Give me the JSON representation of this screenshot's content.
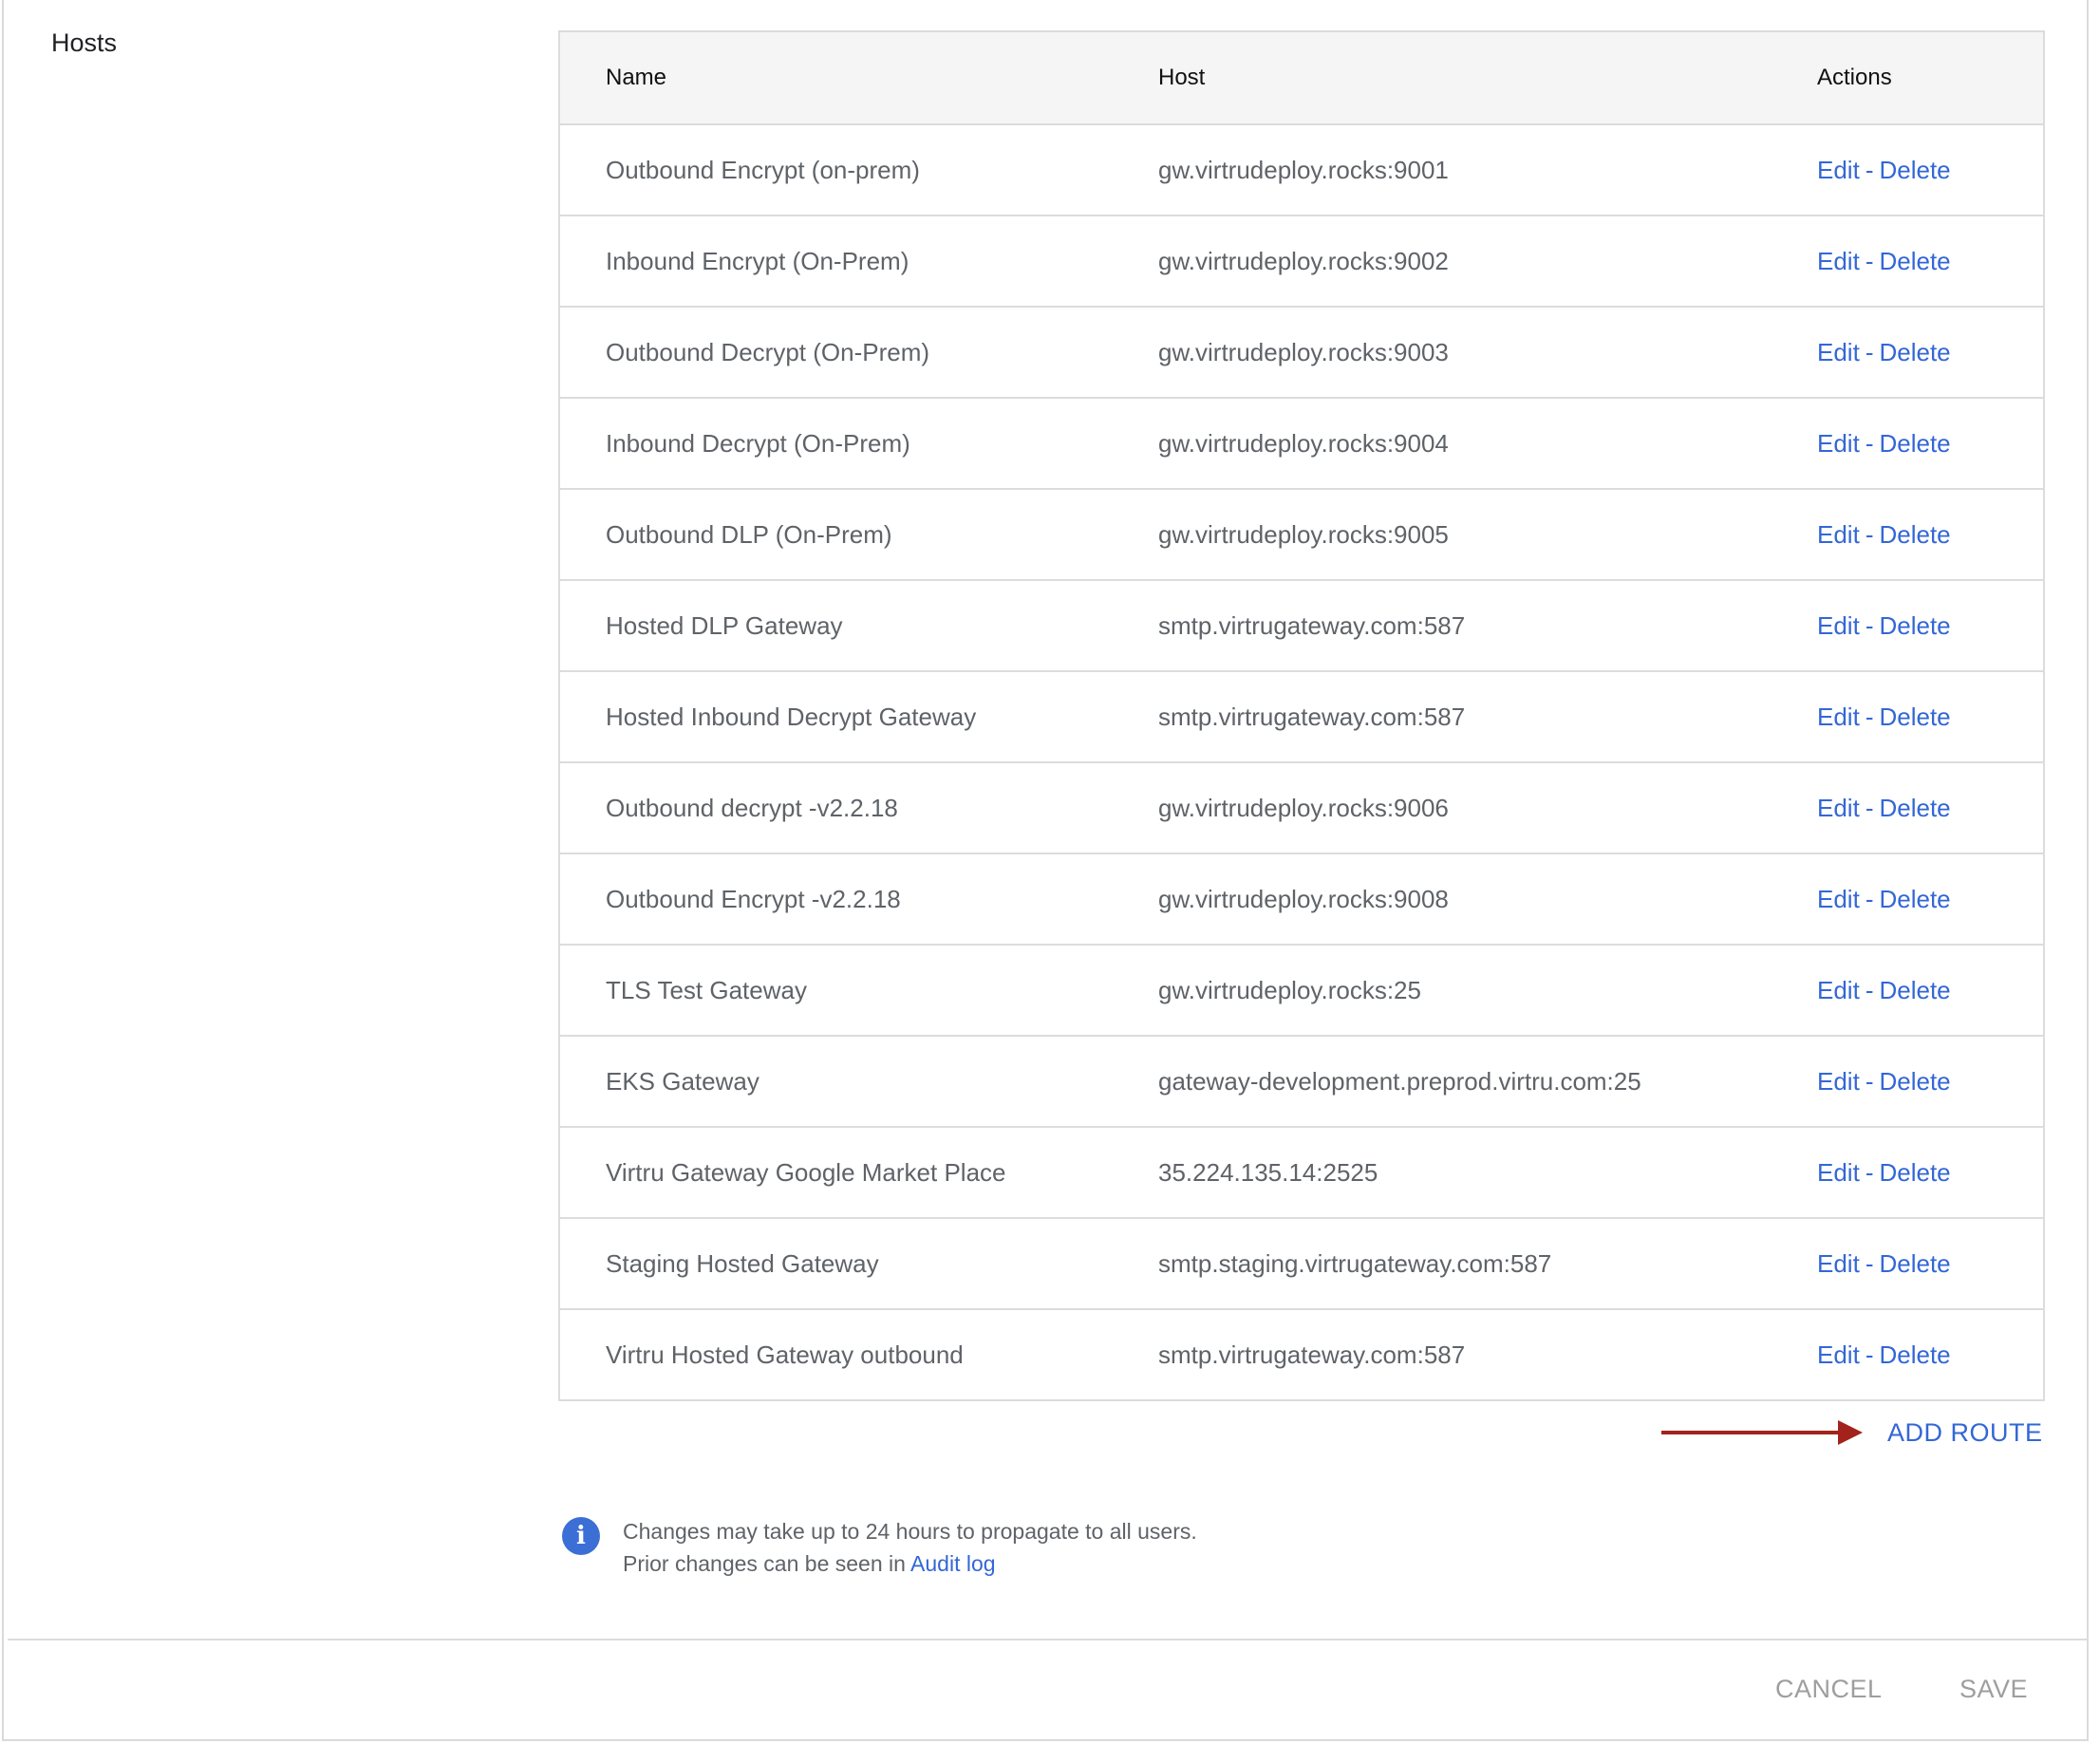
{
  "section": {
    "title": "Hosts"
  },
  "table": {
    "headers": {
      "name": "Name",
      "host": "Host",
      "actions": "Actions"
    },
    "rows": [
      {
        "name": "Outbound Encrypt (on-prem)",
        "host": "gw.virtrudeploy.rocks:9001"
      },
      {
        "name": "Inbound Encrypt (On-Prem)",
        "host": "gw.virtrudeploy.rocks:9002"
      },
      {
        "name": "Outbound Decrypt (On-Prem)",
        "host": "gw.virtrudeploy.rocks:9003"
      },
      {
        "name": "Inbound Decrypt (On-Prem)",
        "host": "gw.virtrudeploy.rocks:9004"
      },
      {
        "name": "Outbound DLP (On-Prem)",
        "host": "gw.virtrudeploy.rocks:9005"
      },
      {
        "name": "Hosted DLP Gateway",
        "host": "smtp.virtrugateway.com:587"
      },
      {
        "name": "Hosted Inbound Decrypt Gateway",
        "host": "smtp.virtrugateway.com:587"
      },
      {
        "name": "Outbound decrypt -v2.2.18",
        "host": "gw.virtrudeploy.rocks:9006"
      },
      {
        "name": "Outbound Encrypt -v2.2.18",
        "host": "gw.virtrudeploy.rocks:9008"
      },
      {
        "name": "TLS Test Gateway",
        "host": "gw.virtrudeploy.rocks:25"
      },
      {
        "name": "EKS Gateway",
        "host": "gateway-development.preprod.virtru.com:25"
      },
      {
        "name": "Virtru Gateway Google Market Place",
        "host": "35.224.135.14:2525"
      },
      {
        "name": "Staging Hosted Gateway",
        "host": "smtp.staging.virtrugateway.com:587"
      },
      {
        "name": "Virtru Hosted Gateway outbound",
        "host": "smtp.virtrugateway.com:587"
      }
    ],
    "edit_label": "Edit",
    "separator": "-",
    "delete_label": "Delete"
  },
  "add_route_label": "ADD ROUTE",
  "info": {
    "icon": "info-icon",
    "icon_glyph": "i",
    "line1": "Changes may take up to 24 hours to propagate to all users.",
    "line2_prefix": "Prior changes can be seen in",
    "line2_link": "Audit log"
  },
  "footer": {
    "cancel_label": "CANCEL",
    "save_label": "SAVE"
  },
  "colors": {
    "link": "#3367d6",
    "arrow": "#a3231c",
    "header_bg": "#f5f5f5",
    "info_icon": "#3b6fd6"
  }
}
